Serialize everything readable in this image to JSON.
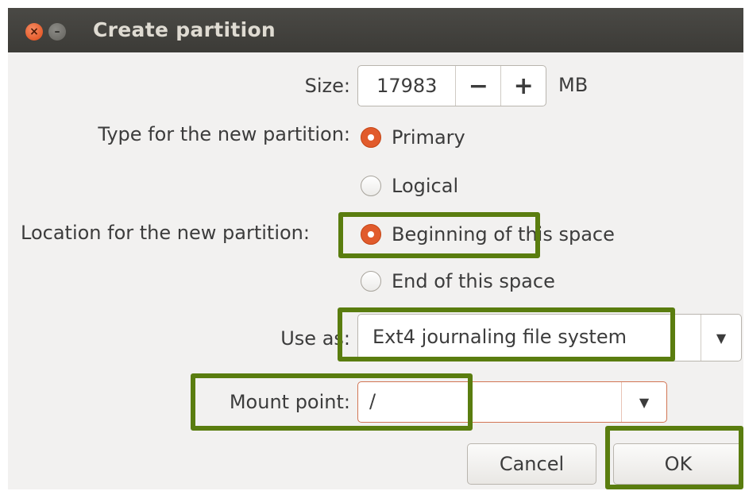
{
  "window": {
    "title": "Create partition",
    "close_glyph": "×",
    "minimize_glyph": "–"
  },
  "form": {
    "size_label": "Size:",
    "size_value": "17983",
    "minus_label": "−",
    "plus_label": "+",
    "size_unit": "MB",
    "type_label": "Type for the new partition:",
    "type_options": [
      "Primary",
      "Logical"
    ],
    "type_selected": "Primary",
    "location_label": "Location for the new partition:",
    "location_options": [
      "Beginning of this space",
      "End of this space"
    ],
    "location_selected": "Beginning of this space",
    "use_as_label": "Use as:",
    "use_as_value": "Ext4 journaling file system",
    "mount_label": "Mount point:",
    "mount_value": "/",
    "dropdown_arrow": "▼"
  },
  "buttons": {
    "cancel": "Cancel",
    "ok": "OK"
  },
  "annotations": {
    "highlight_color": "#5a7d0f"
  }
}
